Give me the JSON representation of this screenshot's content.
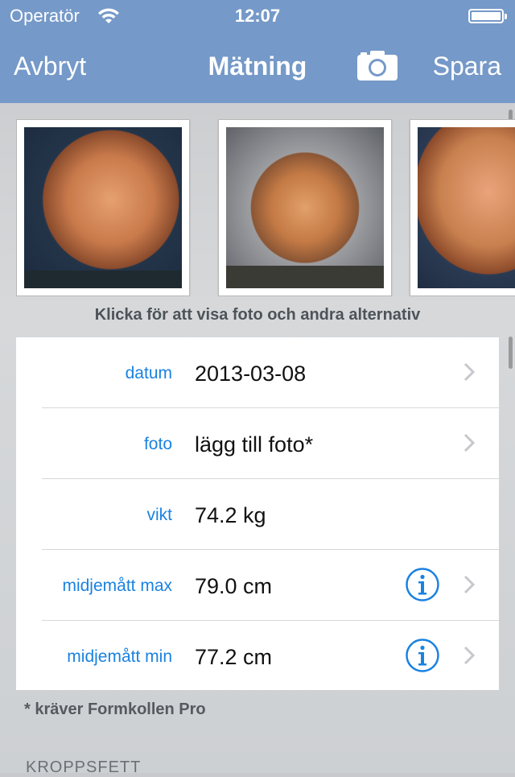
{
  "status": {
    "carrier": "Operatör",
    "time": "12:07"
  },
  "nav": {
    "cancel": "Avbryt",
    "title": "Mätning",
    "save": "Spara"
  },
  "photos_caption": "Klicka för att visa foto och andra alternativ",
  "rows": [
    {
      "label": "datum",
      "value": "2013-03-08",
      "chevron": true,
      "info": false
    },
    {
      "label": "foto",
      "value": "lägg till foto*",
      "chevron": true,
      "info": false
    },
    {
      "label": "vikt",
      "value": "74.2 kg",
      "chevron": false,
      "info": false
    },
    {
      "label": "midjemått max",
      "value": "79.0 cm",
      "chevron": true,
      "info": true
    },
    {
      "label": "midjemått min",
      "value": "77.2 cm",
      "chevron": true,
      "info": true
    }
  ],
  "footnote": "* kräver Formkollen Pro",
  "section_header": "KROPPSFETT",
  "colors": {
    "nav_bar": "#7599c8",
    "label_blue": "#1a82e0"
  }
}
